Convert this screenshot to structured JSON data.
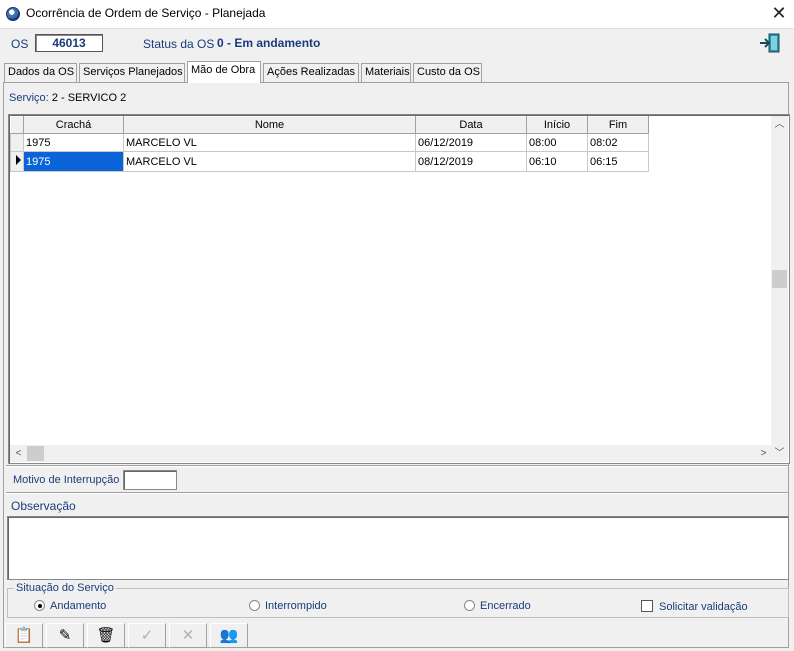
{
  "window": {
    "title": "Ocorrência de Ordem de Serviço - Planejada",
    "close_glyph": "✕"
  },
  "header": {
    "os_label": "OS",
    "os_number": "46013",
    "status_label": "Status da OS",
    "status_value": "0 - Em andamento",
    "exit_icon": "exit-door-icon"
  },
  "tabs": [
    {
      "label": "Dados da OS",
      "active": false
    },
    {
      "label": "Serviços Planejados",
      "active": false
    },
    {
      "label": "Mão de Obra",
      "active": true
    },
    {
      "label": "Ações Realizadas",
      "active": false
    },
    {
      "label": "Materiais",
      "active": false
    },
    {
      "label": "Custo da OS",
      "active": false
    }
  ],
  "servico": {
    "label": "Serviço:",
    "value": "2 - SERVICO 2"
  },
  "grid": {
    "columns": [
      "Crachá",
      "Nome",
      "Data",
      "Início",
      "Fim"
    ],
    "rows": [
      {
        "cracha": "1975",
        "nome": "MARCELO VL",
        "data": "06/12/2019",
        "inicio": "08:00",
        "fim": "08:02",
        "selected": false
      },
      {
        "cracha": "1975",
        "nome": "MARCELO VL",
        "data": "08/12/2019",
        "inicio": "06:10",
        "fim": "06:15",
        "selected": true
      }
    ]
  },
  "motivo": {
    "label": "Motivo de Interrupção",
    "value": ""
  },
  "observacao": {
    "label": "Observação",
    "value": ""
  },
  "situacao": {
    "title": "Situação do Serviço",
    "options": [
      {
        "label": "Andamento",
        "checked": true
      },
      {
        "label": "Interrompido",
        "checked": false
      },
      {
        "label": "Encerrado",
        "checked": false
      }
    ],
    "solicitar_label": "Solicitar validação",
    "solicitar_checked": false
  },
  "toolbar": {
    "buttons": [
      {
        "icon": "new-record-icon",
        "glyph": "📋",
        "enabled": true
      },
      {
        "icon": "edit-record-icon",
        "glyph": "✎",
        "enabled": true
      },
      {
        "icon": "delete-trash-icon",
        "glyph": "🗑",
        "enabled": true
      },
      {
        "icon": "confirm-check-icon",
        "glyph": "✓",
        "enabled": false
      },
      {
        "icon": "cancel-x-icon",
        "glyph": "✕",
        "enabled": false
      },
      {
        "icon": "people-icon",
        "glyph": "👥",
        "enabled": true
      }
    ]
  }
}
